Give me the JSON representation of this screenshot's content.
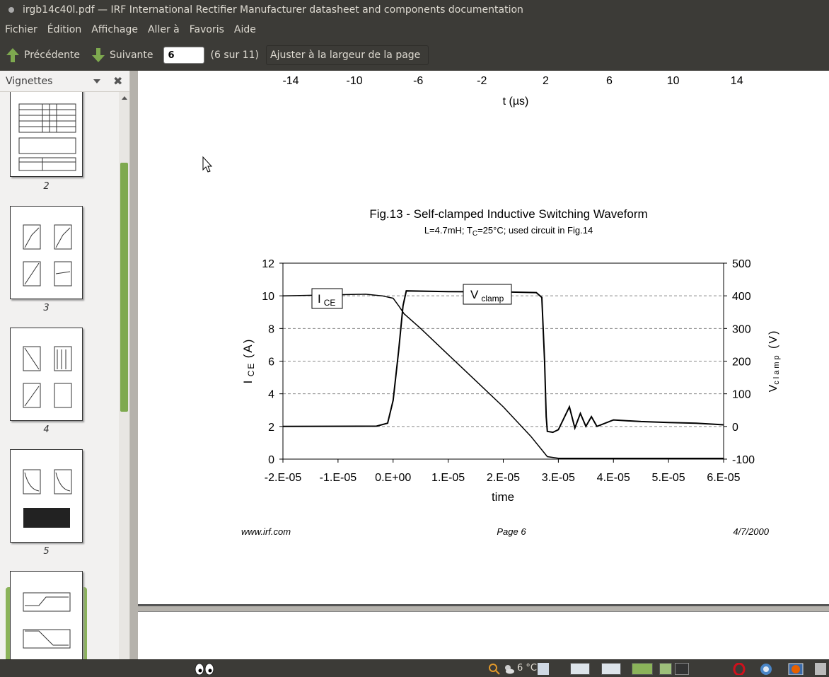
{
  "window": {
    "title": "irgb14c40l.pdf — IRF International Rectifier Manufacturer datasheet and components documentation"
  },
  "menu": [
    "Fichier",
    "Édition",
    "Affichage",
    "Aller à",
    "Favoris",
    "Aide"
  ],
  "toolbar": {
    "prev_label": "Précédente",
    "next_label": "Suivante",
    "page_value": "6",
    "page_count": "(6 sur 11)",
    "zoom_label": "Ajuster à la largeur de la page"
  },
  "sidebar": {
    "title": "Vignettes",
    "thumbnails": [
      {
        "number": "2"
      },
      {
        "number": "3"
      },
      {
        "number": "4"
      },
      {
        "number": "5"
      },
      {
        "number": "6",
        "current": true
      }
    ]
  },
  "previous_figure": {
    "x_ticks": [
      "-14",
      "-10",
      "-6",
      "-2",
      "2",
      "6",
      "10",
      "14"
    ],
    "xlabel": "t (µs)"
  },
  "figure": {
    "title": "Fig.13 - Self-clamped Inductive Switching Waveform",
    "subtitle_prefix": "L=4.7mH; T",
    "subtitle_sub": "C",
    "subtitle_suffix": "=25°C; used circuit in Fig.14"
  },
  "footer": {
    "left": "www.irf.com",
    "center": "Page 6",
    "right": "4/7/2000"
  },
  "taskbar": {
    "temperature": "6 °C"
  },
  "chart_data": {
    "type": "line",
    "xlabel": "time",
    "ylabel_left": "I CE (A)",
    "ylabel_right": "V clamp (V)",
    "xlim": [
      -2e-05,
      6e-05
    ],
    "ylim_left": [
      0,
      12
    ],
    "ylim_right": [
      -100,
      500
    ],
    "x_tick_labels": [
      "-2.E-05",
      "-1.E-05",
      "0.E+00",
      "1.E-05",
      "2.E-05",
      "3.E-05",
      "4.E-05",
      "5.E-05",
      "6.E-05"
    ],
    "y_left_tick_labels": [
      "0",
      "2",
      "4",
      "6",
      "8",
      "10",
      "12"
    ],
    "y_right_tick_labels": [
      "-100",
      "0",
      "100",
      "200",
      "300",
      "400",
      "500"
    ],
    "grid": "horizontal dashed",
    "annotations": [
      {
        "text": "I",
        "sub": "CE"
      },
      {
        "text": "V",
        "sub": "clamp"
      }
    ],
    "series": [
      {
        "name": "I CE",
        "axis": "left",
        "x": [
          -2e-05,
          -5e-06,
          -2e-06,
          0.0,
          1e-06,
          2e-06,
          5e-06,
          1e-05,
          1.5e-05,
          2e-05,
          2.5e-05,
          2.8e-05,
          3e-05,
          4e-05,
          5e-05,
          6e-05
        ],
        "values": [
          10.0,
          10.1,
          10.0,
          9.85,
          9.4,
          8.9,
          8.0,
          6.4,
          4.8,
          3.2,
          1.4,
          0.15,
          0.05,
          0.05,
          0.05,
          0.05
        ]
      },
      {
        "name": "V clamp",
        "axis": "right",
        "x": [
          -2e-05,
          -3e-06,
          -1e-06,
          0.0,
          1e-06,
          1.8e-06,
          2.4e-06,
          1e-05,
          2e-05,
          2.6e-05,
          2.7e-05,
          2.75e-05,
          2.78e-05,
          2.8e-05,
          2.9e-05,
          3e-05,
          3.2e-05,
          3.3e-05,
          3.4e-05,
          3.5e-05,
          3.6e-05,
          3.7e-05,
          4e-05,
          4.5e-05,
          5e-05,
          5.5e-05,
          6e-05
        ],
        "values": [
          0,
          1,
          10,
          80,
          230,
          370,
          415,
          413,
          412,
          410,
          395,
          200,
          30,
          -15,
          -18,
          -10,
          60,
          -5,
          40,
          0,
          30,
          0,
          20,
          15,
          12,
          10,
          5
        ]
      }
    ]
  }
}
